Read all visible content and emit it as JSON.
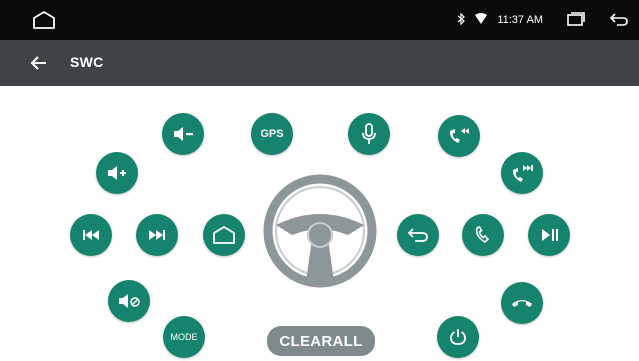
{
  "status_bar": {
    "time": "11:37 AM"
  },
  "app_bar": {
    "title": "SWC"
  },
  "buttons": {
    "gps": "GPS",
    "mode": "MODE",
    "clear_all": "CLEARALL"
  },
  "colors": {
    "accent": "#15836d",
    "app_bar": "#3d4347",
    "status_bar": "#0a0a0a",
    "wheel": "#8d9699"
  }
}
